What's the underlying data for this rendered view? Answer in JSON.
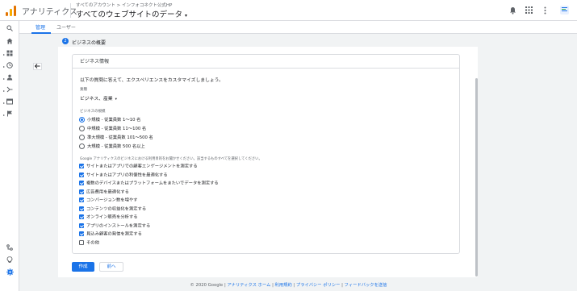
{
  "app": {
    "title": "アナリティクス",
    "breadcrumb": "すべてのアカウント > インフォコネクト公式HP",
    "account_name": "すべてのウェブサイトのデータ",
    "account_caret": "▾"
  },
  "toolbar_icons": [
    "bell-icon",
    "apps-icon",
    "more-icon",
    "account-icon"
  ],
  "left_nav": [
    "search-icon",
    "home-icon",
    "customization-icon",
    "realtime-icon",
    "audience-icon",
    "acquisition-icon",
    "behavior-icon",
    "conversions-icon",
    "attribution-icon",
    "discover-icon",
    "admin-icon"
  ],
  "tabs": [
    "管理",
    "ユーザー"
  ],
  "step": {
    "number": "2",
    "title": "ビジネスの概要"
  },
  "card": {
    "header": "ビジネス情報",
    "intro": "以下の質問に答えて、エクスペリエンスをカスタマイズしましょう。",
    "industry_label": "業種",
    "industry_value": "ビジネス、産業",
    "size_label": "ビジネスの規模",
    "sizes": [
      {
        "label": "小規模 - 従業員数 1〜10 名",
        "selected": true
      },
      {
        "label": "中規模 - 従業員数 11〜100 名",
        "selected": false
      },
      {
        "label": "準大規模 - 従業員数 101〜500 名",
        "selected": false
      },
      {
        "label": "大規模 - 従業員数 500 名以上",
        "selected": false
      }
    ],
    "purpose_label": "Google アナリティクスのビジネスにおける利用目的をお聞かせください。該当するものすべてを選択してください。",
    "purposes": [
      {
        "label": "サイトまたはアプリでの顧客エンゲージメントを測定する",
        "checked": true
      },
      {
        "label": "サイトまたはアプリの利便性を最適化する",
        "checked": true
      },
      {
        "label": "複数のデバイスまたはプラットフォームをまたいでデータを測定する",
        "checked": true
      },
      {
        "label": "広告費用を最適化する",
        "checked": true
      },
      {
        "label": "コンバージョン数を増やす",
        "checked": true
      },
      {
        "label": "コンテンツの収益化を測定する",
        "checked": true
      },
      {
        "label": "オンライン販売を分析する",
        "checked": true
      },
      {
        "label": "アプリのインストールを測定する",
        "checked": true
      },
      {
        "label": "見込み顧客の発信を測定する",
        "checked": true
      },
      {
        "label": "その他",
        "checked": false
      }
    ]
  },
  "buttons": {
    "create": "作成",
    "previous": "前へ"
  },
  "footer": {
    "copyright": "© 2020 Google",
    "links": [
      "アナリティクス ホーム",
      "利用規約",
      "プライバシー ポリシー",
      "フィードバックを送信"
    ],
    "separator": " | "
  },
  "colors": {
    "accent": "#1a73e8",
    "logo_orange": "#e37400",
    "logo_yellow": "#f9ab00"
  }
}
